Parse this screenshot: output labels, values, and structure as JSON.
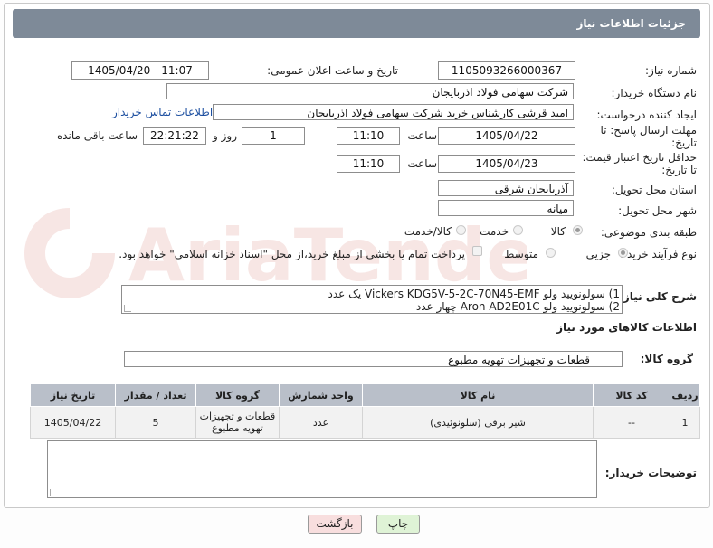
{
  "header": {
    "title": "جزئیات اطلاعات نیاز"
  },
  "form": {
    "need_number_label": "شماره نیاز:",
    "need_number": "1105093266000367",
    "announce_label": "تاریخ و ساعت اعلان عمومی:",
    "announce_value": "1405/04/20 - 11:07",
    "buyer_org_label": "نام دستگاه خریدار:",
    "buyer_org": "شرکت سهامی فولاد اذربایجان",
    "requester_label": "ایجاد کننده درخواست:",
    "requester": "امید قرشی کارشناس خرید شرکت سهامی فولاد اذربایجان",
    "contact_link": "اطلاعات تماس خریدار",
    "deadline_label": "مهلت ارسال پاسخ: تا تاریخ:",
    "deadline_date": "1405/04/22",
    "time_label": "ساعت",
    "deadline_time": "11:10",
    "days_value": "1",
    "days_label": "روز و",
    "remaining_time": "22:21:22",
    "remaining_label": "ساعت باقی مانده",
    "price_valid_label": "حداقل تاریخ اعتبار قیمت: تا تاریخ:",
    "price_valid_date": "1405/04/23",
    "price_valid_time": "11:10",
    "province_label": "استان محل تحویل:",
    "province": "آذربایجان شرقی",
    "city_label": "شهر محل تحویل:",
    "city": "میانه",
    "category_label": "طبقه بندی موضوعی:",
    "category_options": [
      "کالا",
      "خدمت",
      "کالا/خدمت"
    ],
    "category_selected": "کالا",
    "process_label": "نوع فرآیند خرید :",
    "process_options": [
      "جزیی",
      "متوسط"
    ],
    "process_selected": "جزیی",
    "payment_note": "پرداخت تمام یا بخشی از مبلغ خرید،از محل \"اسناد خزانه اسلامی\" خواهد بود.",
    "description_label": "شرح کلی نیاز:",
    "description_lines": [
      "1) سولونویید ولو Vickers KDG5V-5-2C-70N45-EMF یک عدد",
      "2) سولونویید ولو Aron AD2E01C چهار عدد"
    ]
  },
  "goods": {
    "section_title": "اطلاعات کالاهای مورد نیاز",
    "group_label": "گروه کالا:",
    "group_value": "قطعات و تجهیزات تهویه مطبوع",
    "columns": [
      "ردیف",
      "کد کالا",
      "نام کالا",
      "واحد شمارش",
      "گروه کالا",
      "تعداد / مقدار",
      "تاریخ نیاز"
    ],
    "rows": [
      [
        "1",
        "--",
        "شیر برقی (سلونوئیدی)",
        "عدد",
        "قطعات و تجهیزات تهویه مطبوع",
        "5",
        "1405/04/22"
      ]
    ]
  },
  "buyer_notes": {
    "label": "توضیحات خریدار:",
    "value": ""
  },
  "buttons": {
    "print": "چاپ",
    "back": "بازگشت"
  },
  "watermark": {
    "text": "AriaTender.net"
  },
  "colors": {
    "title_bar": "#7e8a98",
    "table_header": "#b9bfc9",
    "print_button": "#dff3d6",
    "back_button": "#f8dede"
  }
}
